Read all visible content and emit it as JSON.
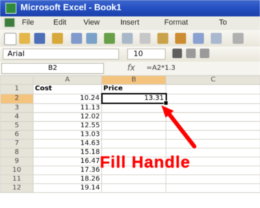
{
  "window": {
    "title": "Microsoft Excel - Book1"
  },
  "menu": {
    "items": [
      "File",
      "Edit",
      "View",
      "Insert",
      "Format",
      "To"
    ]
  },
  "font": {
    "name": "Arial",
    "size": "10"
  },
  "formula_bar": {
    "cell_ref": "B2",
    "fx": "fx",
    "value": "=A2*1.3"
  },
  "columns": [
    "A",
    "B",
    "C"
  ],
  "rows": [
    {
      "n": "1",
      "a": "Cost",
      "b": "Price"
    },
    {
      "n": "2",
      "a": "10.24",
      "b": "13.31"
    },
    {
      "n": "3",
      "a": "11.13",
      "b": ""
    },
    {
      "n": "4",
      "a": "12.02",
      "b": ""
    },
    {
      "n": "5",
      "a": "12.55",
      "b": ""
    },
    {
      "n": "6",
      "a": "13.03",
      "b": ""
    },
    {
      "n": "7",
      "a": "14.63",
      "b": ""
    },
    {
      "n": "8",
      "a": "15.18",
      "b": ""
    },
    {
      "n": "9",
      "a": "16.47",
      "b": ""
    },
    {
      "n": "10",
      "a": "17.36",
      "b": ""
    },
    {
      "n": "11",
      "a": "18.26",
      "b": ""
    },
    {
      "n": "12",
      "a": "19.14",
      "b": ""
    }
  ],
  "annotation": {
    "label": "Fill Handle",
    "color": "#ff0000"
  }
}
